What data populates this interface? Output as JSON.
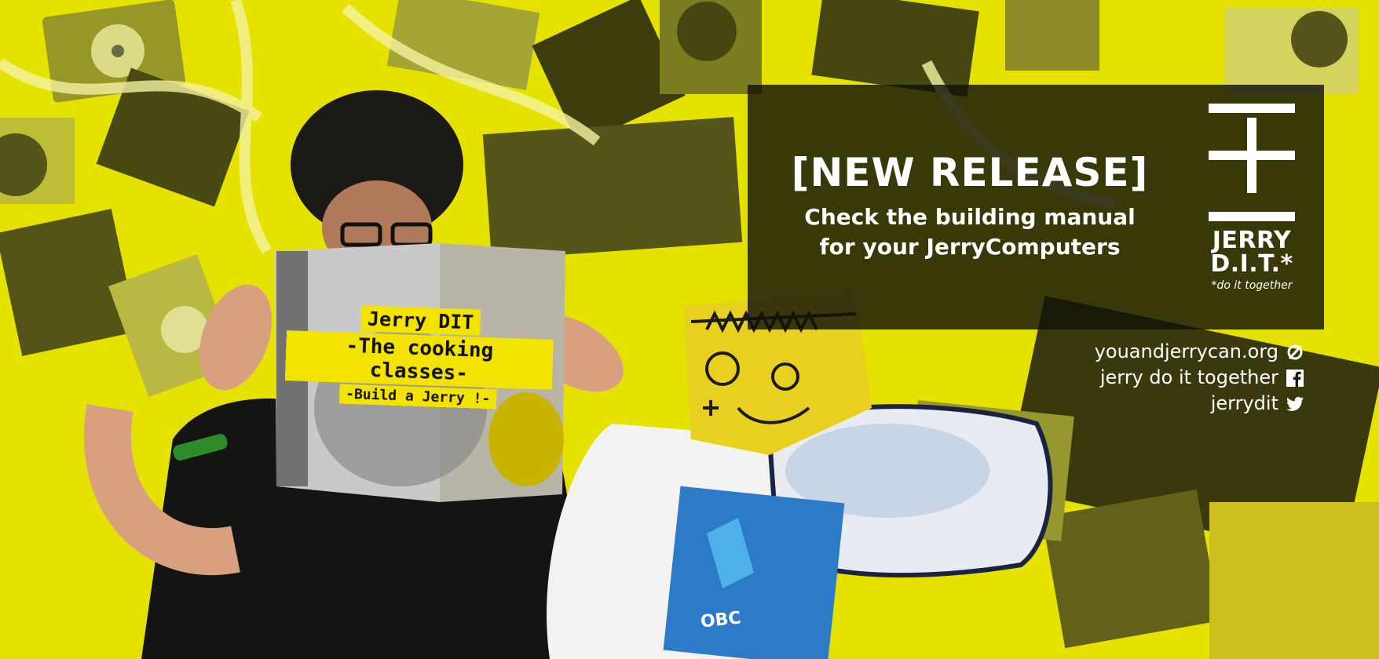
{
  "banner": {
    "headline": "[NEW RELEASE]",
    "subline_1": "Check the building manual",
    "subline_2": "for your JerryComputers"
  },
  "logo": {
    "name_line_1": "JERRY",
    "name_line_2": "D.I.T.*",
    "tagline": "*do it together"
  },
  "links": [
    {
      "text": "youandjerrycan.org",
      "icon": "no-symbol-icon"
    },
    {
      "text": "jerry do it together",
      "icon": "facebook-icon"
    },
    {
      "text": "jerrydit",
      "icon": "twitter-bird-icon"
    }
  ],
  "book": {
    "line_1": "Jerry DIT",
    "line_2": "-The cooking classes-",
    "line_3": "-Build a Jerry !-"
  },
  "poster_text": "OBC",
  "colors": {
    "background_yellow": "#e8e400",
    "panel_dark": "#12120a",
    "text_white": "#ffffff"
  }
}
